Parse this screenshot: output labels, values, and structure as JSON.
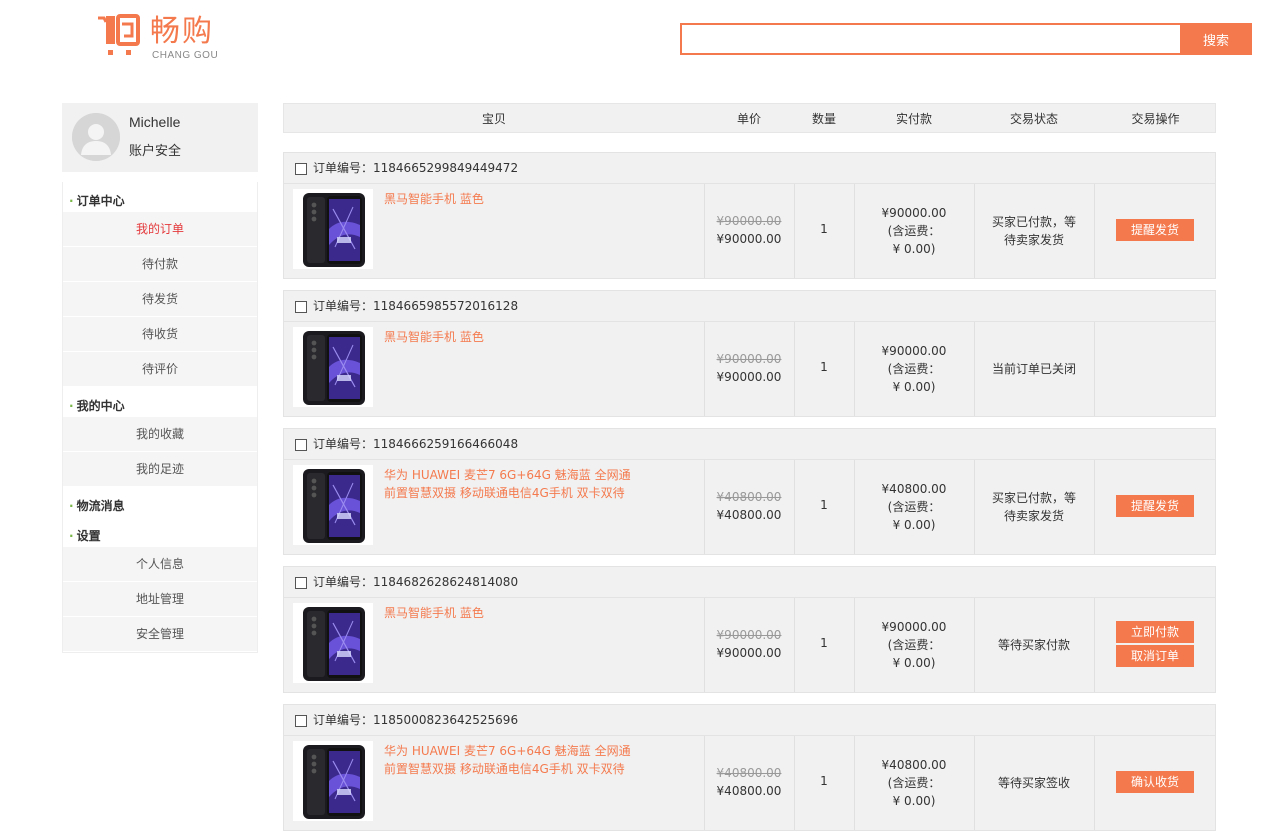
{
  "header": {
    "logo_name": "畅购",
    "logo_sub": "CHANG GOU",
    "search_value": "",
    "search_button": "搜索"
  },
  "sidebar": {
    "user_name": "Michelle",
    "account_security": "账户安全",
    "groups": [
      {
        "title": "订单中心",
        "items": [
          "我的订单",
          "待付款",
          "待发货",
          "待收货",
          "待评价"
        ]
      },
      {
        "title": "我的中心",
        "items": [
          "我的收藏",
          "我的足迹"
        ]
      },
      {
        "title": "物流消息",
        "items": []
      },
      {
        "title": "设置",
        "items": [
          "个人信息",
          "地址管理",
          "安全管理"
        ]
      }
    ],
    "active_item": "我的订单"
  },
  "table_header": [
    "宝贝",
    "单价",
    "数量",
    "实付款",
    "交易状态",
    "交易操作"
  ],
  "order_no_label": "订单编号：",
  "shipping_label": "(含运费：",
  "orders": [
    {
      "order_no": "1184665299849449472",
      "product": "黑马智能手机 蓝色",
      "old_price": "¥90000.00",
      "price": "¥90000.00",
      "qty": "1",
      "paid": "¥90000.00",
      "shipping_fee": "¥ 0.00)",
      "status": "买家已付款，等待卖家发货",
      "actions": [
        "提醒发货"
      ]
    },
    {
      "order_no": "1184665985572016128",
      "product": "黑马智能手机 蓝色",
      "old_price": "¥90000.00",
      "price": "¥90000.00",
      "qty": "1",
      "paid": "¥90000.00",
      "shipping_fee": "¥ 0.00)",
      "status": "当前订单已关闭",
      "actions": []
    },
    {
      "order_no": "1184666259166466048",
      "product": "华为 HUAWEI 麦芒7 6G+64G 魅海蓝 全网通 前置智慧双摄 移动联通电信4G手机 双卡双待",
      "old_price": "¥40800.00",
      "price": "¥40800.00",
      "qty": "1",
      "paid": "¥40800.00",
      "shipping_fee": "¥ 0.00)",
      "status": "买家已付款，等待卖家发货",
      "actions": [
        "提醒发货"
      ]
    },
    {
      "order_no": "1184682628624814080",
      "product": "黑马智能手机 蓝色",
      "old_price": "¥90000.00",
      "price": "¥90000.00",
      "qty": "1",
      "paid": "¥90000.00",
      "shipping_fee": "¥ 0.00)",
      "status": "等待买家付款",
      "actions": [
        "立即付款",
        "取消订单"
      ]
    },
    {
      "order_no": "1185000823642525696",
      "product": "华为 HUAWEI 麦芒7 6G+64G 魅海蓝 全网通 前置智慧双摄 移动联通电信4G手机 双卡双待",
      "old_price": "¥40800.00",
      "price": "¥40800.00",
      "qty": "1",
      "paid": "¥40800.00",
      "shipping_fee": "¥ 0.00)",
      "status": "等待买家签收",
      "actions": [
        "确认收货"
      ]
    }
  ],
  "colors": {
    "accent": "#f47a4e",
    "active_menu": "#e4393c",
    "dot": "#7ab648"
  }
}
